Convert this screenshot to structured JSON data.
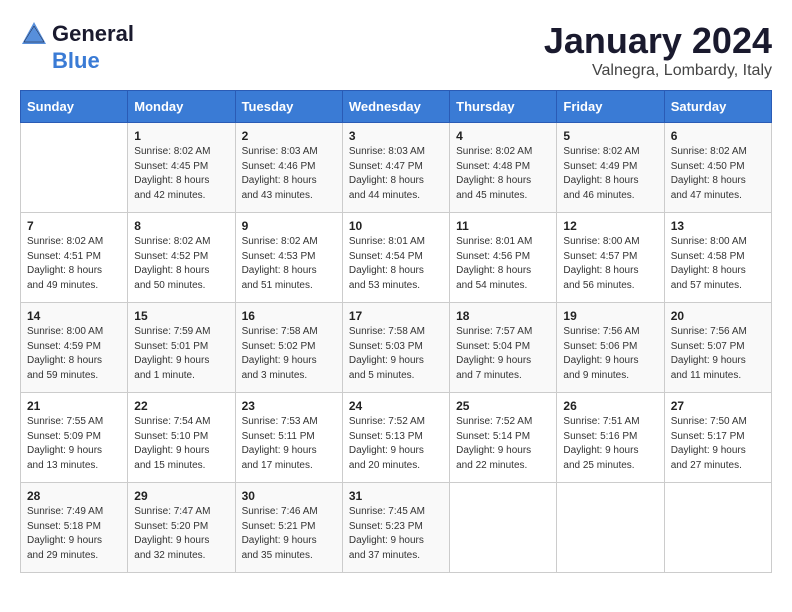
{
  "header": {
    "logo_general": "General",
    "logo_blue": "Blue",
    "month_title": "January 2024",
    "location": "Valnegra, Lombardy, Italy"
  },
  "weekdays": [
    "Sunday",
    "Monday",
    "Tuesday",
    "Wednesday",
    "Thursday",
    "Friday",
    "Saturday"
  ],
  "weeks": [
    [
      {
        "num": "",
        "info": ""
      },
      {
        "num": "1",
        "info": "Sunrise: 8:02 AM\nSunset: 4:45 PM\nDaylight: 8 hours\nand 42 minutes."
      },
      {
        "num": "2",
        "info": "Sunrise: 8:03 AM\nSunset: 4:46 PM\nDaylight: 8 hours\nand 43 minutes."
      },
      {
        "num": "3",
        "info": "Sunrise: 8:03 AM\nSunset: 4:47 PM\nDaylight: 8 hours\nand 44 minutes."
      },
      {
        "num": "4",
        "info": "Sunrise: 8:02 AM\nSunset: 4:48 PM\nDaylight: 8 hours\nand 45 minutes."
      },
      {
        "num": "5",
        "info": "Sunrise: 8:02 AM\nSunset: 4:49 PM\nDaylight: 8 hours\nand 46 minutes."
      },
      {
        "num": "6",
        "info": "Sunrise: 8:02 AM\nSunset: 4:50 PM\nDaylight: 8 hours\nand 47 minutes."
      }
    ],
    [
      {
        "num": "7",
        "info": "Sunrise: 8:02 AM\nSunset: 4:51 PM\nDaylight: 8 hours\nand 49 minutes."
      },
      {
        "num": "8",
        "info": "Sunrise: 8:02 AM\nSunset: 4:52 PM\nDaylight: 8 hours\nand 50 minutes."
      },
      {
        "num": "9",
        "info": "Sunrise: 8:02 AM\nSunset: 4:53 PM\nDaylight: 8 hours\nand 51 minutes."
      },
      {
        "num": "10",
        "info": "Sunrise: 8:01 AM\nSunset: 4:54 PM\nDaylight: 8 hours\nand 53 minutes."
      },
      {
        "num": "11",
        "info": "Sunrise: 8:01 AM\nSunset: 4:56 PM\nDaylight: 8 hours\nand 54 minutes."
      },
      {
        "num": "12",
        "info": "Sunrise: 8:00 AM\nSunset: 4:57 PM\nDaylight: 8 hours\nand 56 minutes."
      },
      {
        "num": "13",
        "info": "Sunrise: 8:00 AM\nSunset: 4:58 PM\nDaylight: 8 hours\nand 57 minutes."
      }
    ],
    [
      {
        "num": "14",
        "info": "Sunrise: 8:00 AM\nSunset: 4:59 PM\nDaylight: 8 hours\nand 59 minutes."
      },
      {
        "num": "15",
        "info": "Sunrise: 7:59 AM\nSunset: 5:01 PM\nDaylight: 9 hours\nand 1 minute."
      },
      {
        "num": "16",
        "info": "Sunrise: 7:58 AM\nSunset: 5:02 PM\nDaylight: 9 hours\nand 3 minutes."
      },
      {
        "num": "17",
        "info": "Sunrise: 7:58 AM\nSunset: 5:03 PM\nDaylight: 9 hours\nand 5 minutes."
      },
      {
        "num": "18",
        "info": "Sunrise: 7:57 AM\nSunset: 5:04 PM\nDaylight: 9 hours\nand 7 minutes."
      },
      {
        "num": "19",
        "info": "Sunrise: 7:56 AM\nSunset: 5:06 PM\nDaylight: 9 hours\nand 9 minutes."
      },
      {
        "num": "20",
        "info": "Sunrise: 7:56 AM\nSunset: 5:07 PM\nDaylight: 9 hours\nand 11 minutes."
      }
    ],
    [
      {
        "num": "21",
        "info": "Sunrise: 7:55 AM\nSunset: 5:09 PM\nDaylight: 9 hours\nand 13 minutes."
      },
      {
        "num": "22",
        "info": "Sunrise: 7:54 AM\nSunset: 5:10 PM\nDaylight: 9 hours\nand 15 minutes."
      },
      {
        "num": "23",
        "info": "Sunrise: 7:53 AM\nSunset: 5:11 PM\nDaylight: 9 hours\nand 17 minutes."
      },
      {
        "num": "24",
        "info": "Sunrise: 7:52 AM\nSunset: 5:13 PM\nDaylight: 9 hours\nand 20 minutes."
      },
      {
        "num": "25",
        "info": "Sunrise: 7:52 AM\nSunset: 5:14 PM\nDaylight: 9 hours\nand 22 minutes."
      },
      {
        "num": "26",
        "info": "Sunrise: 7:51 AM\nSunset: 5:16 PM\nDaylight: 9 hours\nand 25 minutes."
      },
      {
        "num": "27",
        "info": "Sunrise: 7:50 AM\nSunset: 5:17 PM\nDaylight: 9 hours\nand 27 minutes."
      }
    ],
    [
      {
        "num": "28",
        "info": "Sunrise: 7:49 AM\nSunset: 5:18 PM\nDaylight: 9 hours\nand 29 minutes."
      },
      {
        "num": "29",
        "info": "Sunrise: 7:47 AM\nSunset: 5:20 PM\nDaylight: 9 hours\nand 32 minutes."
      },
      {
        "num": "30",
        "info": "Sunrise: 7:46 AM\nSunset: 5:21 PM\nDaylight: 9 hours\nand 35 minutes."
      },
      {
        "num": "31",
        "info": "Sunrise: 7:45 AM\nSunset: 5:23 PM\nDaylight: 9 hours\nand 37 minutes."
      },
      {
        "num": "",
        "info": ""
      },
      {
        "num": "",
        "info": ""
      },
      {
        "num": "",
        "info": ""
      }
    ]
  ]
}
